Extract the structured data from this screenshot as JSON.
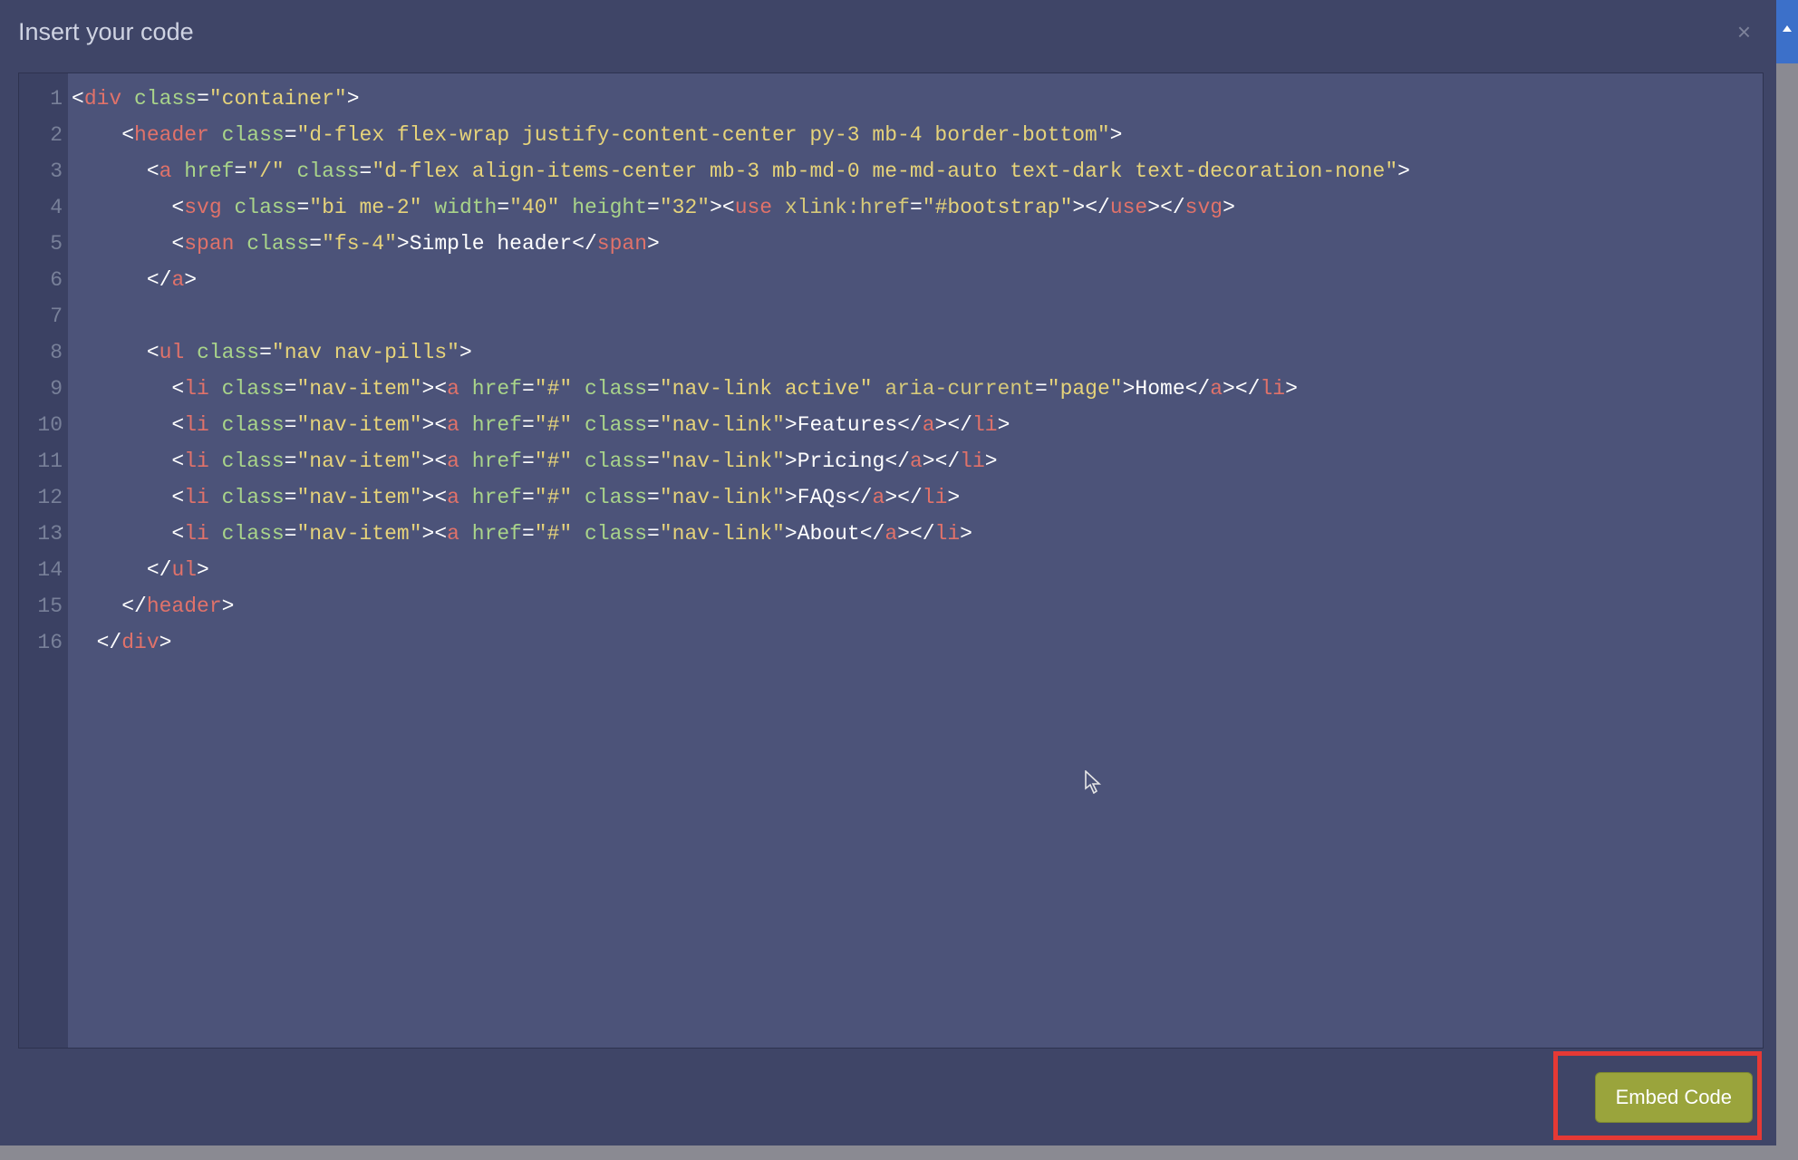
{
  "modal": {
    "title": "Insert your code",
    "close_label": "×"
  },
  "editor": {
    "line_count": 16,
    "code": {
      "l1": {
        "indent": "",
        "open": "<",
        "tag": "div",
        "a1": "class",
        "v1": "container"
      },
      "l2": {
        "indent": "    ",
        "open": "<",
        "tag": "header",
        "a1": "class",
        "v1": "d-flex flex-wrap justify-content-center py-3 mb-4 border-bottom"
      },
      "l3": {
        "indent": "      ",
        "open": "<",
        "tag": "a",
        "a1": "href",
        "v1": "/",
        "a2": "class",
        "v2": "d-flex align-items-center mb-3 mb-md-0 me-md-auto text-dark text-decoration-none"
      },
      "l4": {
        "indent": "        ",
        "open": "<",
        "tag": "svg",
        "a1": "class",
        "v1": "bi me-2",
        "a2": "width",
        "v2": "40",
        "a3": "height",
        "v3": "32",
        "inner_open": "<",
        "inner_tag": "use",
        "inner_attr": "xlink:href",
        "inner_val": "#bootstrap"
      },
      "l5": {
        "indent": "        ",
        "open": "<",
        "tag": "span",
        "a1": "class",
        "v1": "fs-4",
        "text": "Simple header"
      },
      "l6": {
        "indent": "      ",
        "close_tag": "a"
      },
      "l7": {
        "indent": ""
      },
      "l8": {
        "indent": "      ",
        "open": "<",
        "tag": "ul",
        "a1": "class",
        "v1": "nav nav-pills"
      },
      "l9": {
        "indent": "        ",
        "li": true,
        "link_class": "nav-link active",
        "extra_attr": "aria-current",
        "extra_val": "page",
        "text": "Home"
      },
      "l10": {
        "indent": "        ",
        "li": true,
        "link_class": "nav-link",
        "text": "Features"
      },
      "l11": {
        "indent": "        ",
        "li": true,
        "link_class": "nav-link",
        "text": "Pricing"
      },
      "l12": {
        "indent": "        ",
        "li": true,
        "link_class": "nav-link",
        "text": "FAQs"
      },
      "l13": {
        "indent": "        ",
        "li": true,
        "link_class": "nav-link",
        "text": "About"
      },
      "l14": {
        "indent": "      ",
        "close_tag": "ul"
      },
      "l15": {
        "indent": "    ",
        "close_tag": "header"
      },
      "l16": {
        "indent": "  ",
        "close_tag": "div"
      }
    }
  },
  "footer": {
    "embed_label": "Embed Code"
  }
}
